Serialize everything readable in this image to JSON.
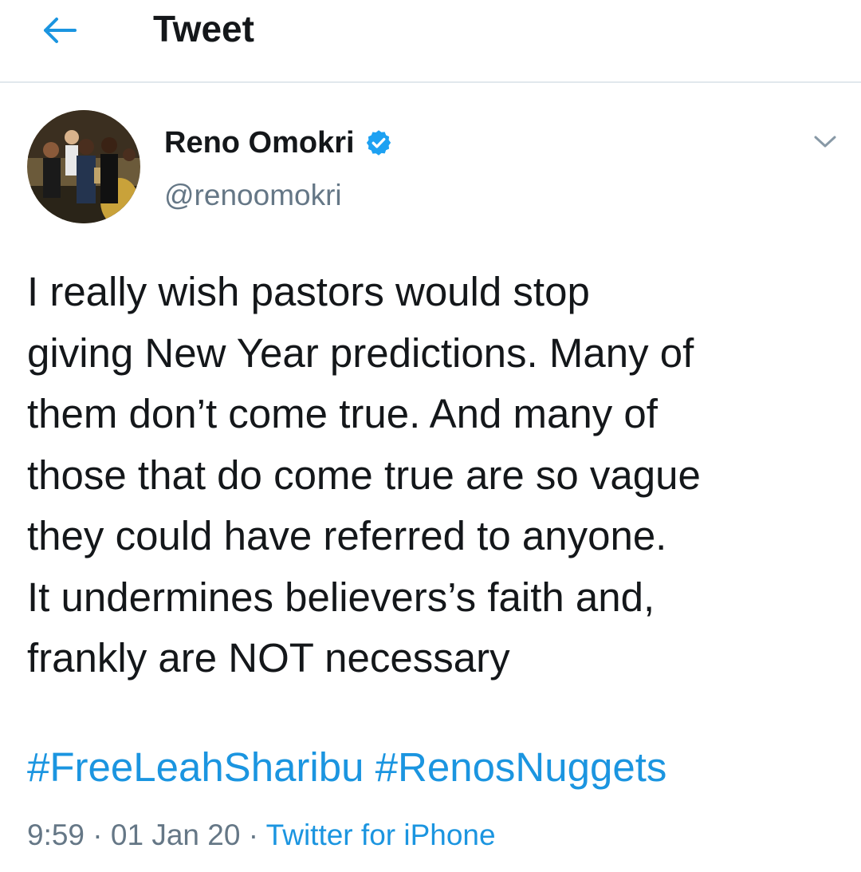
{
  "header": {
    "title": "Tweet",
    "back_icon": "back-arrow-icon"
  },
  "tweet": {
    "author_name": "Reno Omokri",
    "handle": "@renoomokri",
    "verified_icon": "verified-badge-icon",
    "menu_icon": "chevron-down-icon",
    "text": "I really wish pastors would stop\ngiving New Year predictions. Many of\nthem don’t come true. And many of\nthose that do come true are so vague\nthey could have referred to anyone.\nIt undermines believers’s faith and,\nfrankly are NOT necessary",
    "hashtags": [
      "#FreeLeahSharibu",
      "#RenosNuggets"
    ],
    "time": "9:59",
    "date": "01 Jan 20",
    "separator": "·",
    "source": "Twitter for iPhone"
  },
  "colors": {
    "accent": "#1b95e0",
    "text": "#14171a",
    "secondary": "#657786",
    "divider": "#e1e8ed"
  }
}
